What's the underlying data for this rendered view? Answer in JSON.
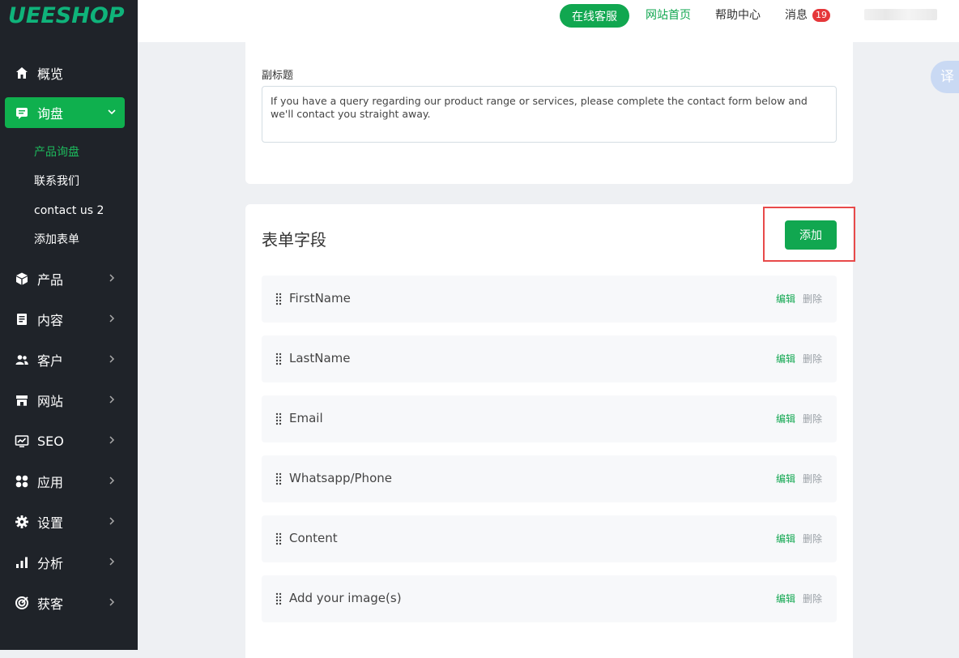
{
  "brand": {
    "logo_text": "UEESHOP",
    "accent": "#11a750"
  },
  "sidebar": {
    "items": [
      {
        "label": "概览",
        "icon": "home-icon"
      },
      {
        "label": "询盘",
        "icon": "message-icon",
        "active": true,
        "expanded": true
      },
      {
        "label": "产品",
        "icon": "box-icon"
      },
      {
        "label": "内容",
        "icon": "document-icon"
      },
      {
        "label": "客户",
        "icon": "users-icon"
      },
      {
        "label": "网站",
        "icon": "store-icon"
      },
      {
        "label": "SEO",
        "icon": "chart-screen-icon"
      },
      {
        "label": "应用",
        "icon": "apps-icon"
      },
      {
        "label": "设置",
        "icon": "gear-icon"
      },
      {
        "label": "分析",
        "icon": "bar-chart-icon"
      },
      {
        "label": "获客",
        "icon": "target-icon"
      }
    ],
    "subitems": [
      {
        "label": "产品询盘",
        "active": true
      },
      {
        "label": "联系我们"
      },
      {
        "label": "contact us 2"
      },
      {
        "label": "添加表单"
      }
    ]
  },
  "topbar": {
    "service_button": "在线客服",
    "home_link": "网站首页",
    "help_link": "帮助中心",
    "messages_label": "消息",
    "messages_count": "19"
  },
  "subtitle_section": {
    "label": "副标题",
    "value": "If you have a query regarding our product range or services, please complete the contact form below and we'll contact you straight away."
  },
  "form_fields": {
    "title": "表单字段",
    "add_button": "添加",
    "edit_label": "编辑",
    "delete_label": "删除",
    "fields": [
      {
        "name": "FirstName"
      },
      {
        "name": "LastName"
      },
      {
        "name": "Email"
      },
      {
        "name": "Whatsapp/Phone"
      },
      {
        "name": "Content"
      },
      {
        "name": "Add your image(s)"
      }
    ]
  },
  "translate_widget": {
    "label": "译"
  }
}
